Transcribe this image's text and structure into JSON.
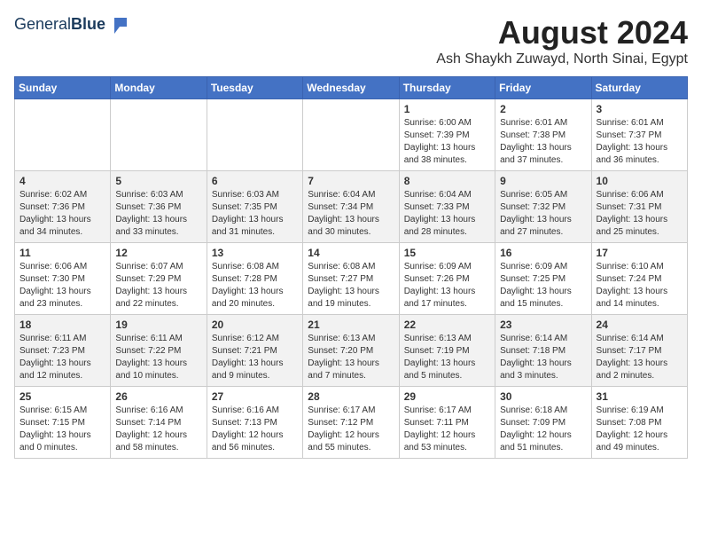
{
  "header": {
    "logo_general": "General",
    "logo_blue": "Blue",
    "month_year": "August 2024",
    "location": "Ash Shaykh Zuwayd, North Sinai, Egypt"
  },
  "days_of_week": [
    "Sunday",
    "Monday",
    "Tuesday",
    "Wednesday",
    "Thursday",
    "Friday",
    "Saturday"
  ],
  "weeks": [
    [
      {
        "day": "",
        "text": ""
      },
      {
        "day": "",
        "text": ""
      },
      {
        "day": "",
        "text": ""
      },
      {
        "day": "",
        "text": ""
      },
      {
        "day": "1",
        "text": "Sunrise: 6:00 AM\nSunset: 7:39 PM\nDaylight: 13 hours\nand 38 minutes."
      },
      {
        "day": "2",
        "text": "Sunrise: 6:01 AM\nSunset: 7:38 PM\nDaylight: 13 hours\nand 37 minutes."
      },
      {
        "day": "3",
        "text": "Sunrise: 6:01 AM\nSunset: 7:37 PM\nDaylight: 13 hours\nand 36 minutes."
      }
    ],
    [
      {
        "day": "4",
        "text": "Sunrise: 6:02 AM\nSunset: 7:36 PM\nDaylight: 13 hours\nand 34 minutes."
      },
      {
        "day": "5",
        "text": "Sunrise: 6:03 AM\nSunset: 7:36 PM\nDaylight: 13 hours\nand 33 minutes."
      },
      {
        "day": "6",
        "text": "Sunrise: 6:03 AM\nSunset: 7:35 PM\nDaylight: 13 hours\nand 31 minutes."
      },
      {
        "day": "7",
        "text": "Sunrise: 6:04 AM\nSunset: 7:34 PM\nDaylight: 13 hours\nand 30 minutes."
      },
      {
        "day": "8",
        "text": "Sunrise: 6:04 AM\nSunset: 7:33 PM\nDaylight: 13 hours\nand 28 minutes."
      },
      {
        "day": "9",
        "text": "Sunrise: 6:05 AM\nSunset: 7:32 PM\nDaylight: 13 hours\nand 27 minutes."
      },
      {
        "day": "10",
        "text": "Sunrise: 6:06 AM\nSunset: 7:31 PM\nDaylight: 13 hours\nand 25 minutes."
      }
    ],
    [
      {
        "day": "11",
        "text": "Sunrise: 6:06 AM\nSunset: 7:30 PM\nDaylight: 13 hours\nand 23 minutes."
      },
      {
        "day": "12",
        "text": "Sunrise: 6:07 AM\nSunset: 7:29 PM\nDaylight: 13 hours\nand 22 minutes."
      },
      {
        "day": "13",
        "text": "Sunrise: 6:08 AM\nSunset: 7:28 PM\nDaylight: 13 hours\nand 20 minutes."
      },
      {
        "day": "14",
        "text": "Sunrise: 6:08 AM\nSunset: 7:27 PM\nDaylight: 13 hours\nand 19 minutes."
      },
      {
        "day": "15",
        "text": "Sunrise: 6:09 AM\nSunset: 7:26 PM\nDaylight: 13 hours\nand 17 minutes."
      },
      {
        "day": "16",
        "text": "Sunrise: 6:09 AM\nSunset: 7:25 PM\nDaylight: 13 hours\nand 15 minutes."
      },
      {
        "day": "17",
        "text": "Sunrise: 6:10 AM\nSunset: 7:24 PM\nDaylight: 13 hours\nand 14 minutes."
      }
    ],
    [
      {
        "day": "18",
        "text": "Sunrise: 6:11 AM\nSunset: 7:23 PM\nDaylight: 13 hours\nand 12 minutes."
      },
      {
        "day": "19",
        "text": "Sunrise: 6:11 AM\nSunset: 7:22 PM\nDaylight: 13 hours\nand 10 minutes."
      },
      {
        "day": "20",
        "text": "Sunrise: 6:12 AM\nSunset: 7:21 PM\nDaylight: 13 hours\nand 9 minutes."
      },
      {
        "day": "21",
        "text": "Sunrise: 6:13 AM\nSunset: 7:20 PM\nDaylight: 13 hours\nand 7 minutes."
      },
      {
        "day": "22",
        "text": "Sunrise: 6:13 AM\nSunset: 7:19 PM\nDaylight: 13 hours\nand 5 minutes."
      },
      {
        "day": "23",
        "text": "Sunrise: 6:14 AM\nSunset: 7:18 PM\nDaylight: 13 hours\nand 3 minutes."
      },
      {
        "day": "24",
        "text": "Sunrise: 6:14 AM\nSunset: 7:17 PM\nDaylight: 13 hours\nand 2 minutes."
      }
    ],
    [
      {
        "day": "25",
        "text": "Sunrise: 6:15 AM\nSunset: 7:15 PM\nDaylight: 13 hours\nand 0 minutes."
      },
      {
        "day": "26",
        "text": "Sunrise: 6:16 AM\nSunset: 7:14 PM\nDaylight: 12 hours\nand 58 minutes."
      },
      {
        "day": "27",
        "text": "Sunrise: 6:16 AM\nSunset: 7:13 PM\nDaylight: 12 hours\nand 56 minutes."
      },
      {
        "day": "28",
        "text": "Sunrise: 6:17 AM\nSunset: 7:12 PM\nDaylight: 12 hours\nand 55 minutes."
      },
      {
        "day": "29",
        "text": "Sunrise: 6:17 AM\nSunset: 7:11 PM\nDaylight: 12 hours\nand 53 minutes."
      },
      {
        "day": "30",
        "text": "Sunrise: 6:18 AM\nSunset: 7:09 PM\nDaylight: 12 hours\nand 51 minutes."
      },
      {
        "day": "31",
        "text": "Sunrise: 6:19 AM\nSunset: 7:08 PM\nDaylight: 12 hours\nand 49 minutes."
      }
    ]
  ]
}
